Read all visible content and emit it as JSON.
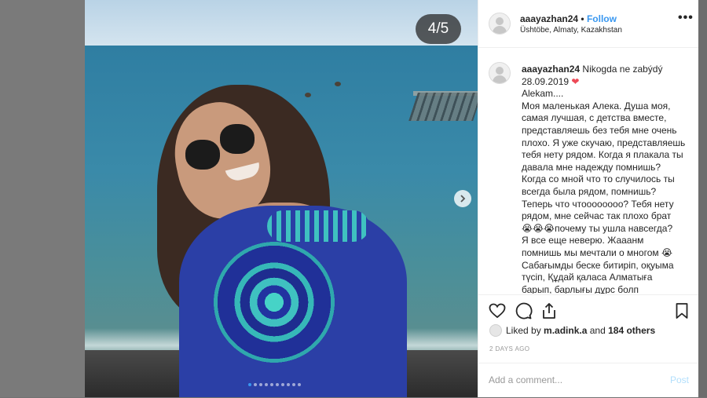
{
  "media": {
    "counter": "4/5",
    "slide_index": 4,
    "slide_total": 5,
    "dot_count": 10,
    "active_dot": 0
  },
  "post": {
    "username": "aaayazhan24",
    "separator": "•",
    "follow_label": "Follow",
    "location": "Üshtöbe, Almaty, Kazakhstan",
    "more_label": "•••"
  },
  "caption": {
    "username": "aaayazhan24",
    "lines": [
      "Nikogda ne zabýdý",
      "28.09.2019 ❤",
      "Alekam....",
      "Моя маленькая Алека. Душа моя,",
      "самая лучшая, с детства вместе,",
      "представляешь без тебя мне очень",
      "плохо. Я уже скучаю, представляешь",
      "тебя нету рядом. Когда я плакала ты",
      "давала мне надежду помнишь?",
      "Когда со мной что то случилось ты",
      "всегда была рядом, помнишь?",
      "Теперь что чтоооооооо? Тебя нету",
      "рядом, мне сейчас так плохо брат",
      "😭😭😭почему ты ушла навсегда?",
      "Я все еще неверю. Жааанм",
      "помнишь мы мечтали о многом 😭",
      "Сабағымды беске битиріп, оқуыма",
      "түсіп, Құдай қаласа Алматыға",
      "барып, барлығы дұрс болп"
    ]
  },
  "likes": {
    "prefix": "Liked by",
    "user": "m.adink.a",
    "middle": "and",
    "others": "184 others"
  },
  "time": "2 DAYS AGO",
  "comment": {
    "placeholder": "Add a comment...",
    "post_label": "Post"
  },
  "colors": {
    "link": "#3897f0",
    "heart": "#ed4956",
    "post_disabled": "#b2dffc"
  },
  "icons": [
    "heart-icon",
    "comment-icon",
    "share-icon",
    "bookmark-icon",
    "chevron-right-icon"
  ]
}
